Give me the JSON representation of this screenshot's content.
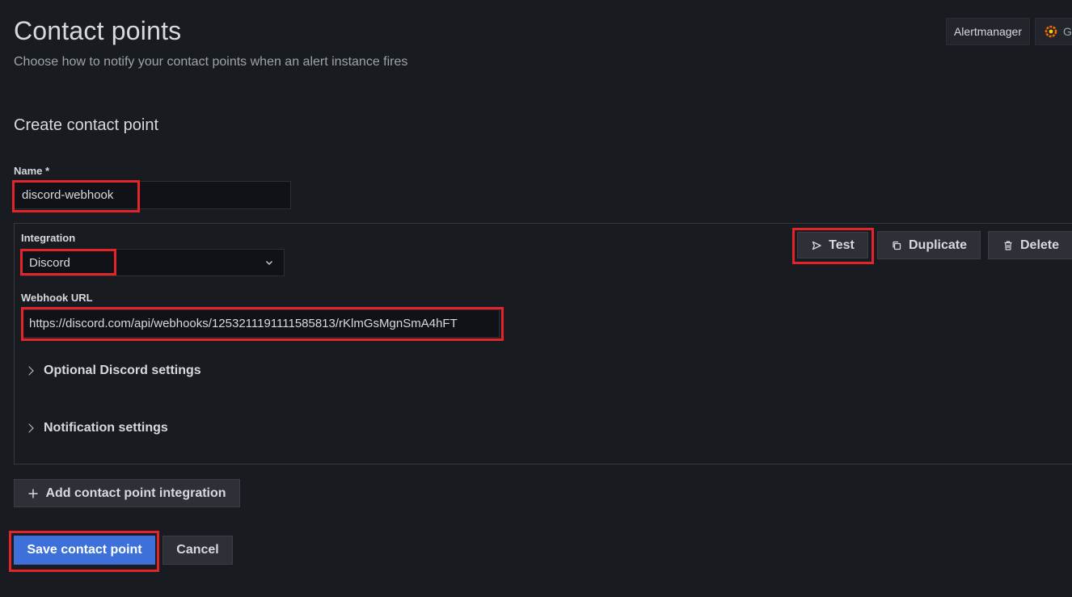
{
  "header": {
    "title": "Contact points",
    "subtitle": "Choose how to notify your contact points when an alert instance fires",
    "alertmanager_label": "Alertmanager",
    "grafana_label": "G"
  },
  "form": {
    "section_title": "Create contact point",
    "name_label": "Name *",
    "name_value": "discord-webhook",
    "integration_label": "Integration",
    "integration_value": "Discord",
    "webhook_label": "Webhook URL",
    "webhook_value": "https://discord.com/api/webhooks/1253211191111585813/rKlmGsMgnSmA4hFT",
    "optional_settings_label": "Optional Discord settings",
    "notification_settings_label": "Notification settings",
    "test_label": "Test",
    "duplicate_label": "Duplicate",
    "delete_label": "Delete",
    "add_integration_label": "Add contact point integration",
    "save_label": "Save contact point",
    "cancel_label": "Cancel"
  },
  "colors": {
    "background": "#181b1f",
    "primary": "#3d71d9",
    "highlight": "#e3242b"
  },
  "icons": [
    "grafana-logo-icon",
    "chevron-down-icon",
    "send-icon",
    "copy-icon",
    "trash-icon",
    "chevron-right-icon",
    "plus-icon"
  ]
}
